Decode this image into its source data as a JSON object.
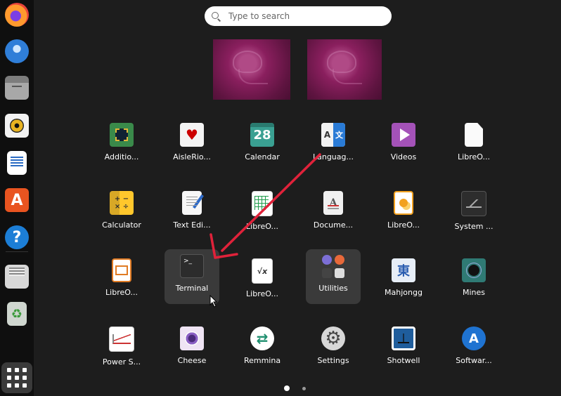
{
  "search": {
    "placeholder": "Type to search"
  },
  "dock": {
    "items": [
      "firefox-icon",
      "thunderbird-icon",
      "files-icon",
      "rhythmbox-icon",
      "libreoffice-writer-icon",
      "app-center-icon",
      "help-icon",
      "save-icon",
      "trash-icon"
    ],
    "show_apps": "show-apps-grid-icon"
  },
  "apps": [
    {
      "label": "Additio...",
      "icon": "additional-drivers-icon"
    },
    {
      "label": "AisleRio...",
      "icon": "aisleriot-cards-icon",
      "glyph": "♥"
    },
    {
      "label": "Calendar",
      "icon": "calendar-icon",
      "glyph": "28"
    },
    {
      "label": "Languag...",
      "icon": "language-support-icon",
      "glyph_l": "A",
      "glyph_r": "文"
    },
    {
      "label": "Videos",
      "icon": "videos-play-icon"
    },
    {
      "label": "LibreO...",
      "icon": "libreoffice-document-icon"
    },
    {
      "label": "Calculator",
      "icon": "calculator-icon"
    },
    {
      "label": "Text Edi...",
      "icon": "text-editor-icon"
    },
    {
      "label": "LibreO...",
      "icon": "libreoffice-calc-icon"
    },
    {
      "label": "Docume...",
      "icon": "document-viewer-icon",
      "glyph": "A"
    },
    {
      "label": "LibreO...",
      "icon": "libreoffice-draw-icon"
    },
    {
      "label": "System ...",
      "icon": "system-monitor-icon"
    },
    {
      "label": "LibreO...",
      "icon": "libreoffice-impress-icon"
    },
    {
      "label": "Terminal",
      "icon": "terminal-icon",
      "glyph": ">_"
    },
    {
      "label": "LibreO...",
      "icon": "libreoffice-math-icon",
      "glyph": "√x"
    },
    {
      "label": "Utilities",
      "icon": "utilities-folder-icon"
    },
    {
      "label": "Mahjongg",
      "icon": "mahjongg-icon",
      "glyph": "東"
    },
    {
      "label": "Mines",
      "icon": "mines-icon"
    },
    {
      "label": "Power S...",
      "icon": "power-statistics-icon"
    },
    {
      "label": "Cheese",
      "icon": "cheese-icon"
    },
    {
      "label": "Remmina",
      "icon": "remmina-icon"
    },
    {
      "label": "Settings",
      "icon": "settings-gear-icon"
    },
    {
      "label": "Shotwell",
      "icon": "shotwell-icon"
    },
    {
      "label": "Softwar...",
      "icon": "software-store-icon",
      "glyph": "A"
    }
  ],
  "colors": {
    "annotation_arrow": "#e0223a",
    "focus_bg": "#3a3a3a",
    "background": "#1d1d1d"
  },
  "pages": {
    "current": 1,
    "total": 2
  }
}
